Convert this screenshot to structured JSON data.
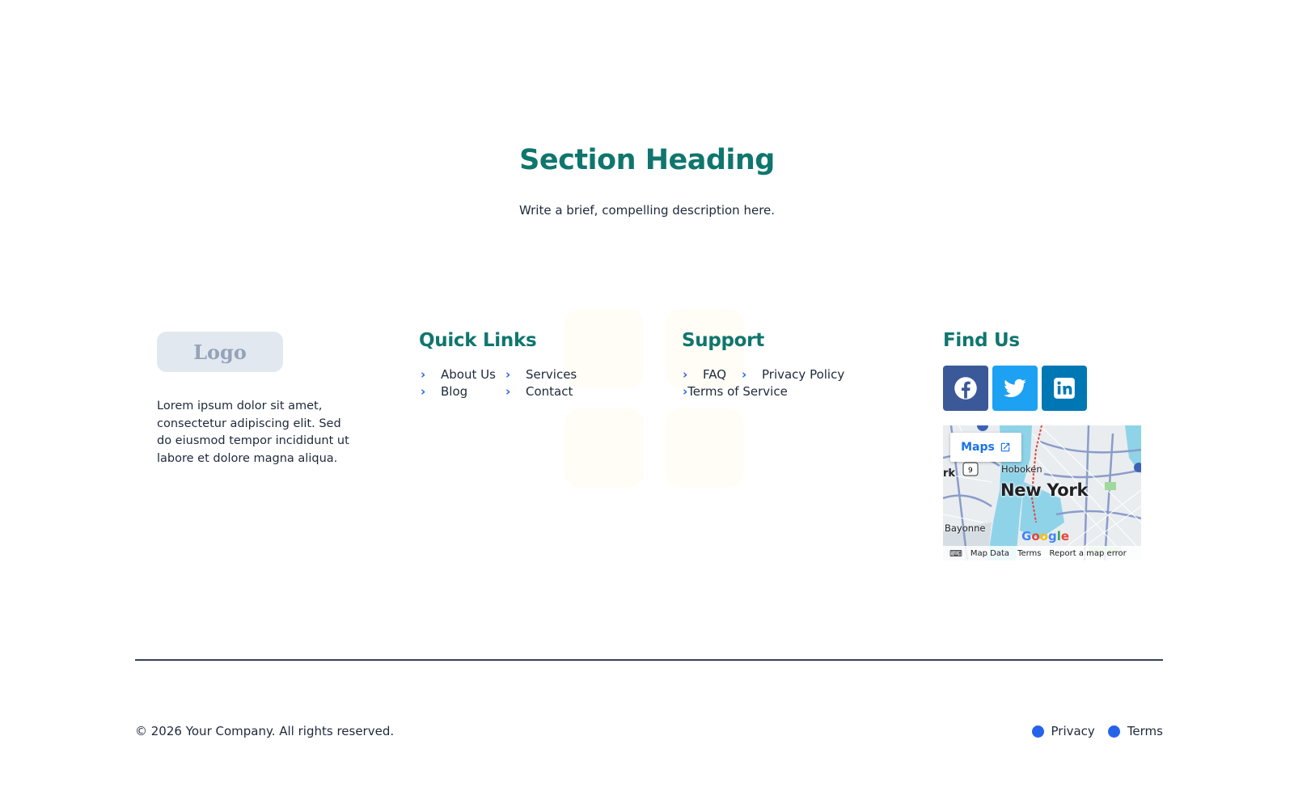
{
  "hero": {
    "heading": "Section Heading",
    "description": "Write a brief, compelling description here."
  },
  "footer": {
    "logo_text": "Logo",
    "about_text": "Lorem ipsum dolor sit amet, consectetur adipiscing elit. Sed do eiusmod tempor incididunt ut labore et dolore magna aliqua.",
    "quick_links": {
      "title": "Quick Links",
      "items": [
        "About Us",
        "Services",
        "Blog",
        "Contact"
      ]
    },
    "support": {
      "title": "Support",
      "items": [
        "FAQ",
        "Privacy Policy",
        "Terms of Service"
      ]
    },
    "find_us": {
      "title": "Find Us",
      "social": [
        {
          "name": "facebook-icon",
          "color": "#3b5998"
        },
        {
          "name": "twitter-icon",
          "color": "#1da1f2"
        },
        {
          "name": "linkedin-icon",
          "color": "#0077b5"
        }
      ],
      "map": {
        "button_label": "Maps",
        "city": "New York",
        "hoboken": "Hoboken",
        "bayonne": "Bayonne",
        "edge_label": "rk",
        "google_label": "Google",
        "footer_links": [
          "Map Data",
          "Terms",
          "Report a map error"
        ]
      }
    },
    "copyright": "© 2026 Your Company. All rights reserved.",
    "legal_links": [
      "Privacy",
      "Terms"
    ]
  },
  "colors": {
    "accent_teal": "#0f766e",
    "link_blue": "#2563eb"
  }
}
